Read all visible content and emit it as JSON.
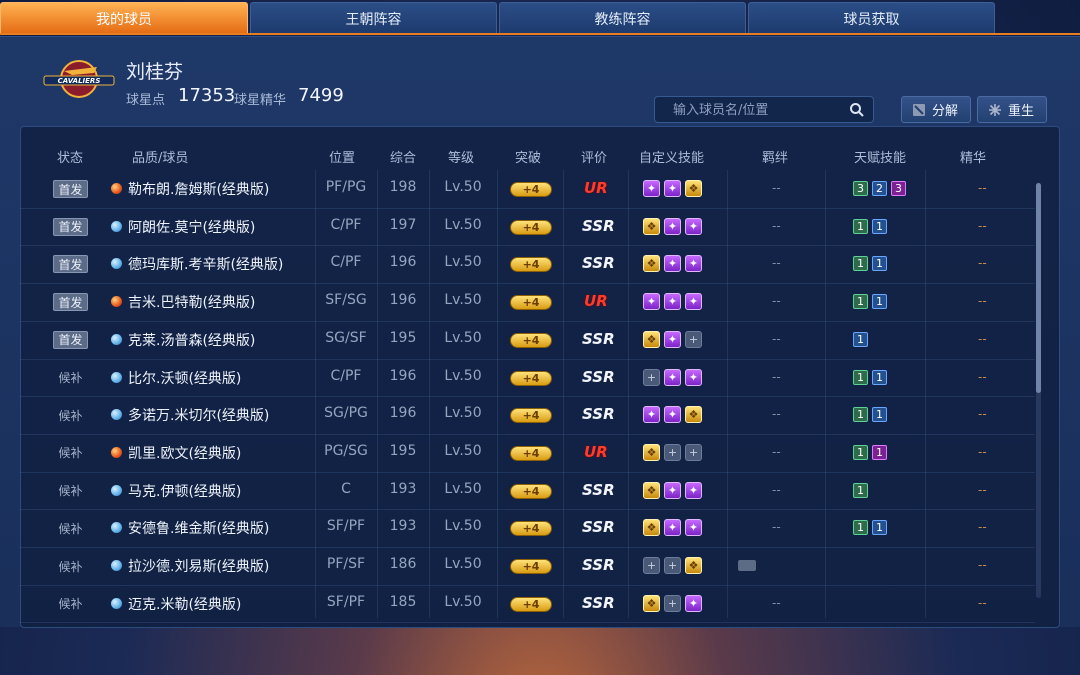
{
  "tabs": [
    {
      "label": "我的球员",
      "active": true
    },
    {
      "label": "王朝阵容",
      "active": false
    },
    {
      "label": "教练阵容",
      "active": false
    },
    {
      "label": "球员获取",
      "active": false
    }
  ],
  "profile": {
    "name": "刘桂芬",
    "star_points_label": "球星点",
    "star_points": "17353",
    "essence_label": "球星精华",
    "essence": "7499",
    "logo_text": "CAVALIERS"
  },
  "search": {
    "placeholder": "输入球员名/位置"
  },
  "buttons": {
    "decompose": "分解",
    "rebirth": "重生"
  },
  "headers": [
    "状态",
    "品质/球员",
    "位置",
    "综合",
    "等级",
    "突破",
    "评价",
    "自定义技能",
    "羁绊",
    "天赋技能",
    "精华"
  ],
  "colors": {
    "accent": "#e97d23",
    "ur": "#ff3b2b"
  },
  "players": [
    {
      "status": "首发",
      "status_type": "starter",
      "quality": "red",
      "name": "勒布朗.詹姆斯(经典版)",
      "position": "PF/PG",
      "overall": "198",
      "level": "Lv.50",
      "breakthrough": "+4",
      "rating": "UR",
      "skills": [
        "purple",
        "purple",
        "gold"
      ],
      "bond": "--",
      "talents": [
        {
          "v": "3",
          "c": "green"
        },
        {
          "v": "2",
          "c": "blue"
        },
        {
          "v": "3",
          "c": "purple"
        }
      ],
      "essence": "--"
    },
    {
      "status": "首发",
      "status_type": "starter",
      "quality": "blue",
      "name": "阿朗佐.莫宁(经典版)",
      "position": "C/PF",
      "overall": "197",
      "level": "Lv.50",
      "breakthrough": "+4",
      "rating": "SSR",
      "skills": [
        "gold",
        "purple",
        "purple"
      ],
      "bond": "--",
      "talents": [
        {
          "v": "1",
          "c": "green"
        },
        {
          "v": "1",
          "c": "blue"
        }
      ],
      "essence": "--"
    },
    {
      "status": "首发",
      "status_type": "starter",
      "quality": "blue",
      "name": "德玛库斯.考辛斯(经典版)",
      "position": "C/PF",
      "overall": "196",
      "level": "Lv.50",
      "breakthrough": "+4",
      "rating": "SSR",
      "skills": [
        "gold",
        "purple",
        "purple"
      ],
      "bond": "--",
      "talents": [
        {
          "v": "1",
          "c": "green"
        },
        {
          "v": "1",
          "c": "blue"
        }
      ],
      "essence": "--"
    },
    {
      "status": "首发",
      "status_type": "starter",
      "quality": "red",
      "name": "吉米.巴特勒(经典版)",
      "position": "SF/SG",
      "overall": "196",
      "level": "Lv.50",
      "breakthrough": "+4",
      "rating": "UR",
      "skills": [
        "purple",
        "purple",
        "purple"
      ],
      "bond": "--",
      "talents": [
        {
          "v": "1",
          "c": "green"
        },
        {
          "v": "1",
          "c": "blue"
        }
      ],
      "essence": "--"
    },
    {
      "status": "首发",
      "status_type": "starter",
      "quality": "blue",
      "name": "克莱.汤普森(经典版)",
      "position": "SG/SF",
      "overall": "195",
      "level": "Lv.50",
      "breakthrough": "+4",
      "rating": "SSR",
      "skills": [
        "gold",
        "purple",
        "empty"
      ],
      "bond": "--",
      "talents": [
        {
          "v": "1",
          "c": "blue"
        }
      ],
      "essence": "--"
    },
    {
      "status": "候补",
      "status_type": "bench",
      "quality": "blue",
      "name": "比尔.沃顿(经典版)",
      "position": "C/PF",
      "overall": "196",
      "level": "Lv.50",
      "breakthrough": "+4",
      "rating": "SSR",
      "skills": [
        "empty",
        "purple",
        "purple"
      ],
      "bond": "--",
      "talents": [
        {
          "v": "1",
          "c": "green"
        },
        {
          "v": "1",
          "c": "blue"
        }
      ],
      "essence": "--"
    },
    {
      "status": "候补",
      "status_type": "bench",
      "quality": "blue",
      "name": "多诺万.米切尔(经典版)",
      "position": "SG/PG",
      "overall": "196",
      "level": "Lv.50",
      "breakthrough": "+4",
      "rating": "SSR",
      "skills": [
        "purple",
        "purple",
        "gold"
      ],
      "bond": "--",
      "talents": [
        {
          "v": "1",
          "c": "green"
        },
        {
          "v": "1",
          "c": "blue"
        }
      ],
      "essence": "--"
    },
    {
      "status": "候补",
      "status_type": "bench",
      "quality": "red",
      "name": "凯里.欧文(经典版)",
      "position": "PG/SG",
      "overall": "195",
      "level": "Lv.50",
      "breakthrough": "+4",
      "rating": "UR",
      "skills": [
        "gold",
        "empty",
        "empty"
      ],
      "bond": "--",
      "talents": [
        {
          "v": "1",
          "c": "green"
        },
        {
          "v": "1",
          "c": "purple"
        }
      ],
      "essence": "--"
    },
    {
      "status": "候补",
      "status_type": "bench",
      "quality": "blue",
      "name": "马克.伊顿(经典版)",
      "position": "C",
      "overall": "193",
      "level": "Lv.50",
      "breakthrough": "+4",
      "rating": "SSR",
      "skills": [
        "gold",
        "purple",
        "purple"
      ],
      "bond": "--",
      "talents": [
        {
          "v": "1",
          "c": "green"
        }
      ],
      "essence": "--"
    },
    {
      "status": "候补",
      "status_type": "bench",
      "quality": "blue",
      "name": "安德鲁.维金斯(经典版)",
      "position": "SF/PF",
      "overall": "193",
      "level": "Lv.50",
      "breakthrough": "+4",
      "rating": "SSR",
      "skills": [
        "gold",
        "purple",
        "purple"
      ],
      "bond": "--",
      "talents": [
        {
          "v": "1",
          "c": "green"
        },
        {
          "v": "1",
          "c": "blue"
        }
      ],
      "essence": "--"
    },
    {
      "status": "候补",
      "status_type": "bench",
      "quality": "blue",
      "name": "拉沙德.刘易斯(经典版)",
      "position": "PF/SF",
      "overall": "186",
      "level": "Lv.50",
      "breakthrough": "+4",
      "rating": "SSR",
      "skills": [
        "empty",
        "empty",
        "gold"
      ],
      "bond": "icon",
      "talents": [],
      "essence": "--"
    },
    {
      "status": "候补",
      "status_type": "bench",
      "quality": "blue",
      "name": "迈克.米勒(经典版)",
      "position": "SF/PF",
      "overall": "185",
      "level": "Lv.50",
      "breakthrough": "+4",
      "rating": "SSR",
      "skills": [
        "gold",
        "empty",
        "purple"
      ],
      "bond": "--",
      "talents": [],
      "essence": "--"
    }
  ]
}
